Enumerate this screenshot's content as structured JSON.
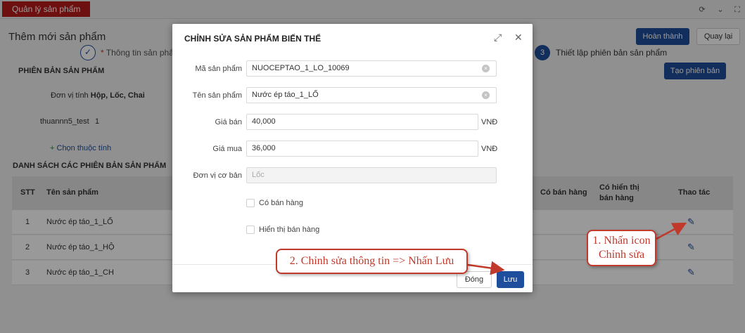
{
  "app": {
    "tab_label": "Quản lý sản phẩm",
    "top_icons": [
      "refresh-icon",
      "chevron-down-icon",
      "fullscreen-icon"
    ]
  },
  "page": {
    "title": "Thêm mới sản phẩm",
    "finish_button": "Hoàn thành",
    "back_button": "Quay lại",
    "steps": [
      {
        "label": "Thông tin sản phẩ",
        "marker": "*",
        "state": "done"
      },
      {
        "number": "3",
        "label": "Thiết lập phiên bản sản phẩm",
        "state": "active"
      }
    ]
  },
  "variants_section": {
    "heading": "PHIÊN BẢN SẢN PHẨM",
    "create_button": "Tạo phiên bản",
    "unit_label": "Đơn vị tính",
    "unit_value": "Hộp, Lốc, Chai",
    "attribute_name": "thuannn5_test",
    "attribute_value": "1",
    "add_attribute": "Chọn thuộc tính"
  },
  "list_section": {
    "heading": "DANH SÁCH CÁC PHIÊN BẢN SẢN PHẨM",
    "columns": {
      "stt": "STT",
      "name": "Tên sản phẩm",
      "for_sale": "Có bán hàng",
      "show_sale_1": "Có hiển thị",
      "show_sale_2": "bán hàng",
      "actions": "Thao tác"
    },
    "rows": [
      {
        "stt": "1",
        "name": "Nước ép táo_1_LỐ"
      },
      {
        "stt": "2",
        "name": "Nước ép táo_1_HỘ"
      },
      {
        "stt": "3",
        "name": "Nước ép táo_1_CH"
      }
    ]
  },
  "modal": {
    "title": "CHỈNH SỬA SẢN PHẨM BIẾN THỂ",
    "fields": {
      "code_label": "Mã sản phẩm",
      "code_value": "NUOCEPTAO_1_LO_10069",
      "name_label": "Tên sản phẩm",
      "name_value": "Nước ép táo_1_LỐ",
      "sell_price_label": "Giá bán",
      "sell_price_value": "40,000",
      "buy_price_label": "Giá mua",
      "buy_price_value": "36,000",
      "currency": "VNĐ",
      "base_unit_label": "Đơn vị cơ bản",
      "base_unit_value": "Lốc"
    },
    "checkboxes": {
      "for_sale": "Có bán hàng",
      "show_sale": "Hiển thị bán hàng"
    },
    "close_button": "Đóng",
    "save_button": "Lưu"
  },
  "annotations": {
    "callout_1_line1": "1. Nhấn icon",
    "callout_1_line2": "Chỉnh sửa",
    "callout_2": "2. Chỉnh sửa thông tin => Nhấn Lưu",
    "color": "#c0392b"
  },
  "colors": {
    "brand_red": "#b71c1c",
    "primary_blue": "#1f4e9c"
  }
}
